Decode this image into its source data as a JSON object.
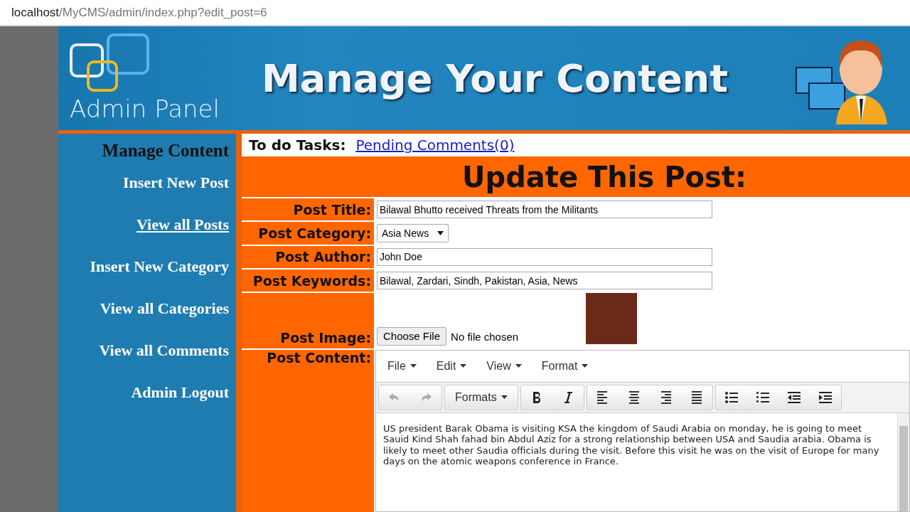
{
  "address_bar": {
    "host": "localhost",
    "path": "/MyCMS/admin/index.php?edit_post=6"
  },
  "header": {
    "logo_text": "Admin Panel",
    "title": "Manage Your Content"
  },
  "sidebar": {
    "heading": "Manage Content",
    "items": [
      {
        "label": "Insert New Post",
        "hovered": false
      },
      {
        "label": "View all Posts",
        "hovered": true
      },
      {
        "label": "Insert New Category",
        "hovered": false
      },
      {
        "label": "View all Categories",
        "hovered": false
      },
      {
        "label": "View all Comments",
        "hovered": false
      },
      {
        "label": "Admin Logout",
        "hovered": false
      }
    ]
  },
  "todo": {
    "label": "To do Tasks:",
    "link": "Pending Comments(0)"
  },
  "form": {
    "heading": "Update This Post:",
    "fields": [
      {
        "kind": "text",
        "label": "Post Title:",
        "value": "Bilawal Bhutto received Threats from the Militants"
      },
      {
        "kind": "select",
        "label": "Post Category:",
        "value": "Asia News"
      },
      {
        "kind": "text",
        "label": "Post Author:",
        "value": "John Doe"
      },
      {
        "kind": "text",
        "label": "Post Keywords:",
        "value": "Bilawal, Zardari, Sindh, Pakistan, Asia, News"
      },
      {
        "kind": "file",
        "label": "Post Image:",
        "button": "Choose File",
        "status": "No file chosen"
      }
    ],
    "content": {
      "label": "Post Content:",
      "menus": [
        "File",
        "Edit",
        "View",
        "Format"
      ],
      "formats": "Formats",
      "text": "US president Barak Obama is visiting KSA the kingdom of Saudi Arabia on monday, he is going to meet Sauid Kind Shah fahad bin Abdul Aziz for a strong relationship between USA and Saudia arabia. Obama is likely to meet other Saudia officials during the visit. Before this visit he was on the visit of Europe for many days on the atomic weapons conference in France."
    }
  }
}
